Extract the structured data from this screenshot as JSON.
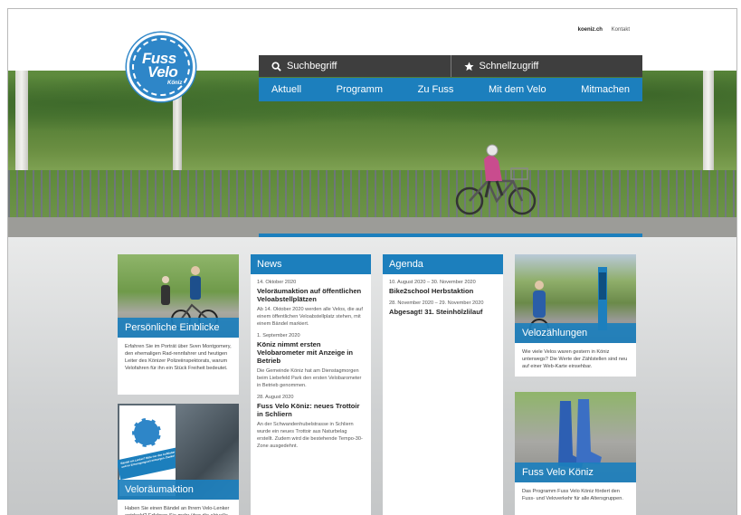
{
  "toplinks": {
    "site": "koeniz.ch",
    "contact": "Kontakt"
  },
  "logo": {
    "line1": "Fuss",
    "line2": "Velo",
    "line3": "Köniz"
  },
  "search": {
    "label": "Suchbegriff",
    "quick": "Schnellzugriff"
  },
  "nav": [
    "Aktuell",
    "Programm",
    "Zu Fuss",
    "Mit dem Velo",
    "Mitmachen"
  ],
  "left_cards": [
    {
      "title": "Persönliche Einblicke",
      "text": "Erfahren Sie im Porträt über Sven Montgomery, den ehemaligen Rad-rennfahrer und heutigen Leiter des Könizer Polizeiinspektorats, warum Velofahren für ihn ein Stück Freiheit bedeutet."
    },
    {
      "title": "Veloräumaktion",
      "text": "Haben Sie einen Bändel an Ihrem Velo-Lenker entdeckt? Erfahren Sie mehr über die aktuelle Veloräumaktion in Köniz.",
      "poster_text": "Bändel am Lenker? Bitte nur das Aufkleber entfernen und im Entsorgungsort entsorgen. Danke!"
    }
  ],
  "news": {
    "heading": "News",
    "items": [
      {
        "date": "14. Oktober 2020",
        "headline": "Veloräumaktion auf öffentlichen Veloabstellplätzen",
        "body": "Ab 14. Oktober 2020 werden alle Velos, die auf einem öffentlichen Veloabstellplatz stehen, mit einem Bändel markiert."
      },
      {
        "date": "1. September 2020",
        "headline": "Köniz nimmt ersten Velobarometer mit Anzeige in Betrieb",
        "body": "Die Gemeinde Köniz hat am Dienstagmorgen beim Liebefeld Park den ersten Velobarometer in Betrieb genommen."
      },
      {
        "date": "28. August 2020",
        "headline": "Fuss Velo Köniz: neues Trottoir in Schliern",
        "body": "An der Schwandenhubelstrasse in Schliern wurde ein neues Trottoir aus Naturbelag erstellt. Zudem wird die bestehende Tempo-30-Zone ausgedehnt."
      }
    ]
  },
  "agenda": {
    "heading": "Agenda",
    "items": [
      {
        "date": "10. August 2020 – 30. November 2020",
        "headline": "Bike2school Herbstaktion"
      },
      {
        "date": "28. November 2020 – 29. November 2020",
        "headline": "Abgesagt! 31. Steinhölzlilauf"
      }
    ]
  },
  "right_cards": [
    {
      "title": "Velozählungen",
      "text": "Wie viele Velos waren gestern in Köniz unterwegs? Die Werte der Zählstellen sind neu auf einer Web-Karte einsehbar."
    },
    {
      "title": "Fuss Velo Köniz",
      "text": "Das Programm Fuss Velo Köniz fördert den Fuss- und Veloverkehr für alle Altersgruppen."
    }
  ],
  "colors": {
    "brand_blue": "#1c7fbd",
    "search_bar": "#3e3e3e",
    "logo_blue": "#2e86c8"
  }
}
